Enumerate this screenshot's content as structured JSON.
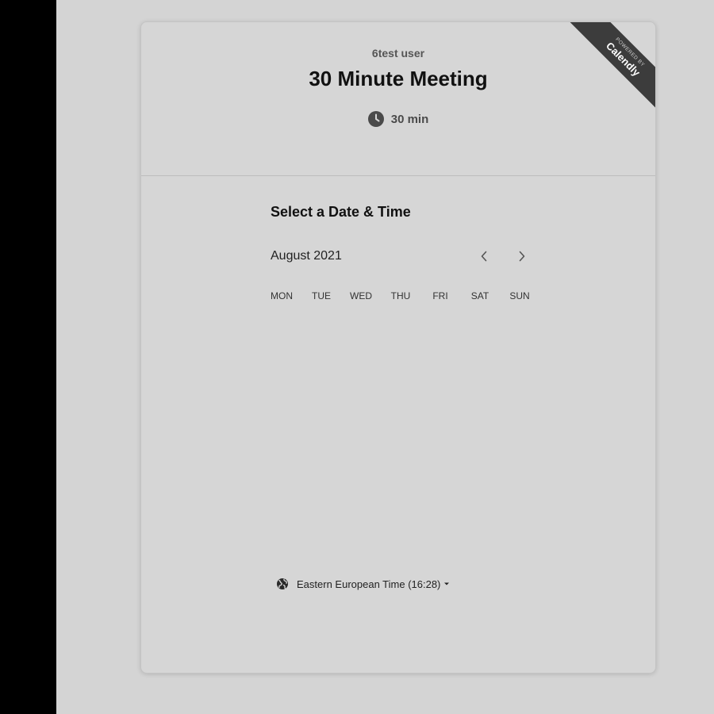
{
  "header": {
    "host_name": "6test user",
    "event_title": "30 Minute Meeting",
    "duration": "30 min",
    "duration_icon": "clock-icon"
  },
  "ribbon": {
    "small_text": "POWERED BY",
    "brand": "Calendly"
  },
  "picker": {
    "title": "Select a Date & Time",
    "month": "August 2021",
    "prev_icon": "chevron-left-icon",
    "next_icon": "chevron-right-icon",
    "weekdays": [
      "MON",
      "TUE",
      "WED",
      "THU",
      "FRI",
      "SAT",
      "SUN"
    ]
  },
  "timezone": {
    "label": "Eastern European Time (16:28)",
    "icon": "globe-icon",
    "caret_icon": "caret-down-icon"
  },
  "colors": {
    "left_bar": "#000000",
    "background": "#d4d4d4",
    "ribbon": "#3c3c3c"
  }
}
